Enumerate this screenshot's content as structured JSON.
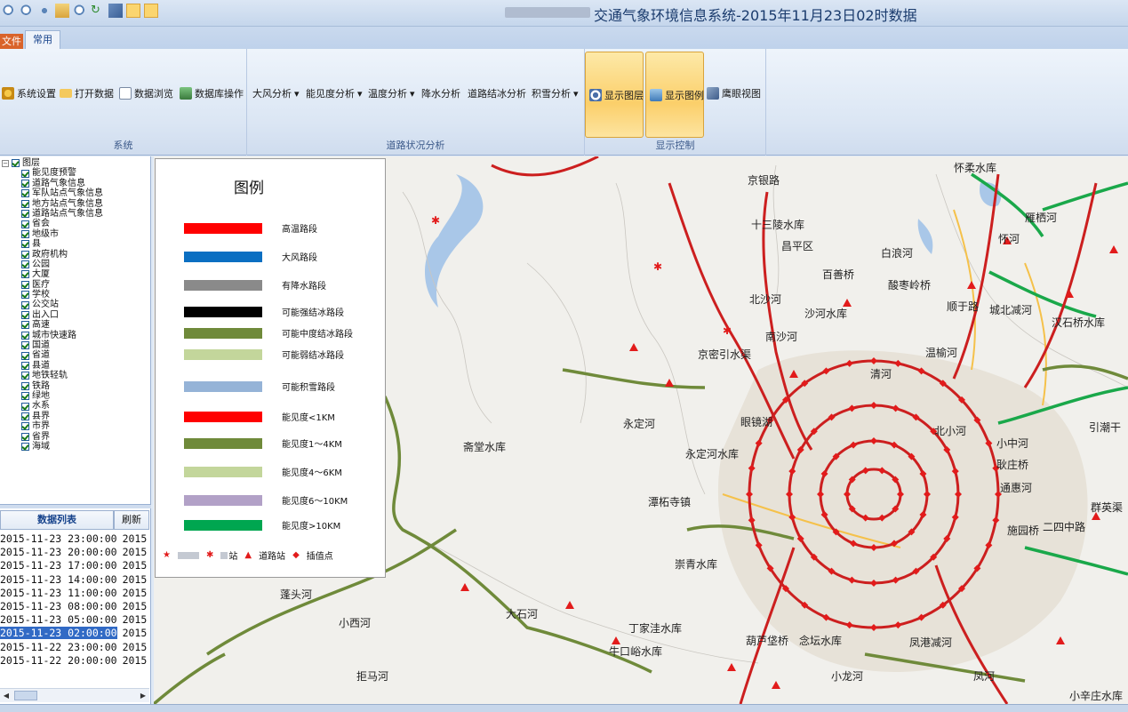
{
  "app": {
    "title": "交通气象环境信息系统-2015年11月23日02时数据"
  },
  "ribbon": {
    "tabs": [
      {
        "label": "文件"
      },
      {
        "label": "常用"
      }
    ],
    "groups": [
      {
        "label": "系统",
        "buttons": [
          "系统设置",
          "打开数据",
          "数据浏览",
          "数据库操作"
        ]
      },
      {
        "label": "道路状况分析",
        "buttons": [
          "大风分析",
          "能见度分析",
          "温度分析",
          "降水分析",
          "道路结冰分析",
          "积雪分析"
        ]
      },
      {
        "label": "显示控制",
        "buttons": [
          "显示图层",
          "显示图例",
          "鹰眼视图"
        ]
      }
    ]
  },
  "layers": {
    "root": "图层",
    "items": [
      "能见度预警",
      "道路气象信息",
      "军队站点气象信息",
      "地方站点气象信息",
      "道路站点气象信息",
      "省会",
      "地级市",
      "县",
      "政府机构",
      "公园",
      "大厦",
      "医疗",
      "学校",
      "公交站",
      "出入口",
      "高速",
      "城市快速路",
      "国道",
      "省道",
      "县道",
      "地铁轻轨",
      "铁路",
      "绿地",
      "水系",
      "县界",
      "市界",
      "省界",
      "海域"
    ]
  },
  "datalist": {
    "title": "数据列表",
    "refresh": "刷新",
    "rows": [
      {
        "dt": "2015-11-23 23:00:00",
        "extra": "2015"
      },
      {
        "dt": "2015-11-23 20:00:00",
        "extra": "2015"
      },
      {
        "dt": "2015-11-23 17:00:00",
        "extra": "2015"
      },
      {
        "dt": "2015-11-23 14:00:00",
        "extra": "2015"
      },
      {
        "dt": "2015-11-23 11:00:00",
        "extra": "2015"
      },
      {
        "dt": "2015-11-23 08:00:00",
        "extra": "2015"
      },
      {
        "dt": "2015-11-23 05:00:00",
        "extra": "2015"
      },
      {
        "dt": "2015-11-23 02:00:00",
        "extra": "2015",
        "selected": true
      },
      {
        "dt": "2015-11-22 23:00:00",
        "extra": "2015"
      },
      {
        "dt": "2015-11-22 20:00:00",
        "extra": "2015"
      }
    ]
  },
  "legend": {
    "title": "图例",
    "items": [
      {
        "label": "高温路段",
        "color": "#ff0000"
      },
      {
        "label": "大风路段",
        "color": "#0b6fc2"
      },
      {
        "label": "有降水路段",
        "color": "#8a8a8a"
      },
      {
        "label": "可能强结冰路段",
        "color": "#000000"
      },
      {
        "label": "可能中度结冰路段",
        "color": "#6f8a3a"
      },
      {
        "label": "可能弱结冰路段",
        "color": "#c3d69b"
      },
      {
        "label": "可能积雪路段",
        "color": "#95b3d7"
      },
      {
        "label": "能见度<1KM",
        "color": "#ff0000"
      },
      {
        "label": "能见度1～4KM",
        "color": "#6f8a3a"
      },
      {
        "label": "能见度4～6KM",
        "color": "#c3d69b"
      },
      {
        "label": "能见度6～10KM",
        "color": "#b2a1c7"
      },
      {
        "label": "能见度>10KM",
        "color": "#00a650"
      }
    ],
    "symbols": [
      "站",
      "道路站",
      "插值点"
    ]
  },
  "map": {
    "labels": [
      {
        "text": "怀柔水库"
      },
      {
        "text": "京银路"
      },
      {
        "text": "十三陵水库"
      },
      {
        "text": "昌平区"
      },
      {
        "text": "白浪河"
      },
      {
        "text": "雁栖河"
      },
      {
        "text": "怀河"
      },
      {
        "text": "百善桥"
      },
      {
        "text": "酸枣岭桥"
      },
      {
        "text": "北沙河"
      },
      {
        "text": "沙河水库"
      },
      {
        "text": "顺于路"
      },
      {
        "text": "城北减河"
      },
      {
        "text": "汉石桥水库"
      },
      {
        "text": "南沙河"
      },
      {
        "text": "温榆河"
      },
      {
        "text": "京密引水渠"
      },
      {
        "text": "清河"
      },
      {
        "text": "斋堂水库"
      },
      {
        "text": "永定河"
      },
      {
        "text": "眼镜湖"
      },
      {
        "text": "北小河"
      },
      {
        "text": "小中河"
      },
      {
        "text": "引潮干"
      },
      {
        "text": "永定河水库"
      },
      {
        "text": "耿庄桥"
      },
      {
        "text": "潭柘寺镇"
      },
      {
        "text": "通惠河"
      },
      {
        "text": "群英渠"
      },
      {
        "text": "施园桥"
      },
      {
        "text": "蓬头河"
      },
      {
        "text": "崇青水库"
      },
      {
        "text": "大石河"
      },
      {
        "text": "小西河"
      },
      {
        "text": "丁家洼水库"
      },
      {
        "text": "牛口峪水库"
      },
      {
        "text": "葫芦垡桥"
      },
      {
        "text": "念坛水库"
      },
      {
        "text": "凤港减河"
      },
      {
        "text": "拒马河"
      },
      {
        "text": "小龙河"
      },
      {
        "text": "凤河"
      },
      {
        "text": "小辛庄水库"
      },
      {
        "text": "二四中路"
      }
    ]
  }
}
